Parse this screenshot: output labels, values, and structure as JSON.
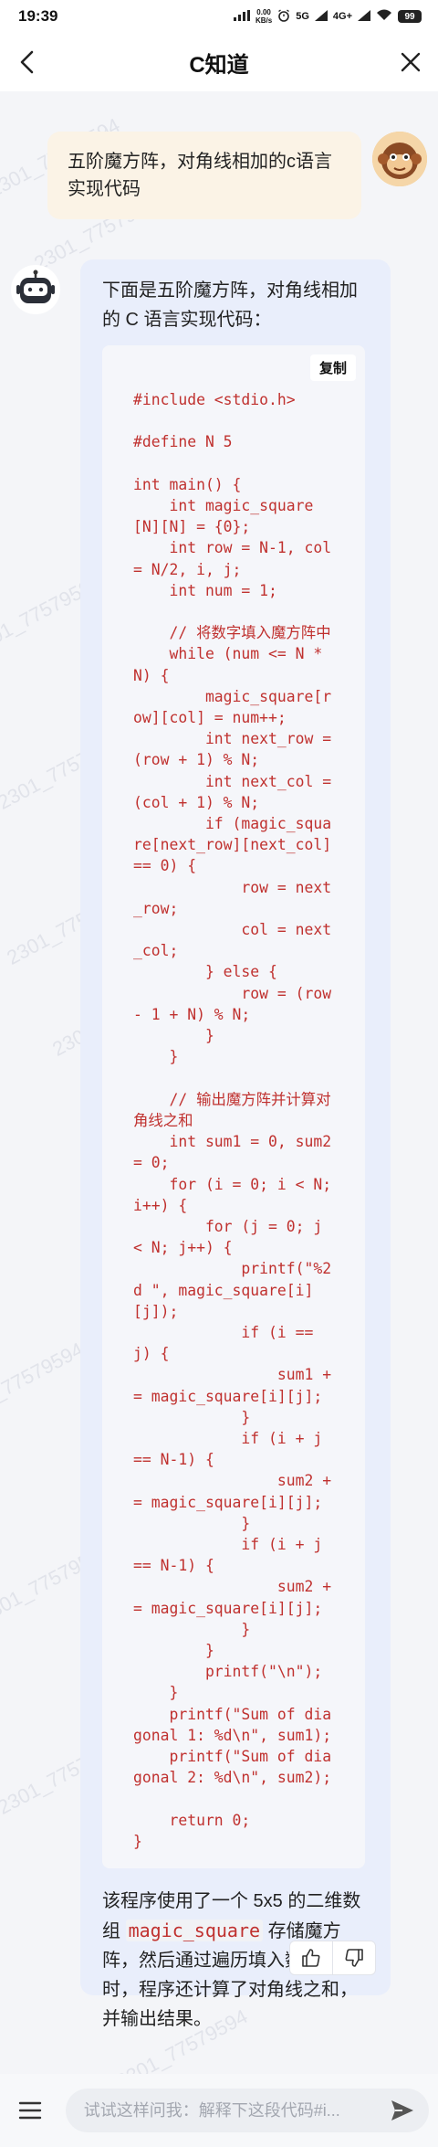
{
  "status": {
    "time": "19:39",
    "net_speed": "0.00\nKB/s",
    "network1": "5G",
    "network2": "4G+",
    "battery": "99"
  },
  "nav": {
    "title": "C知道"
  },
  "user_message": "五阶魔方阵，对角线相加的c语言实现代码",
  "bot": {
    "intro": "下面是五阶魔方阵，对角线相加的 C 语言实现代码：",
    "copy_label": "复制",
    "code": "#include <stdio.h>\n\n#define N 5\n\nint main() {\n    int magic_square\n[N][N] = {0};\n    int row = N-1, col\n= N/2, i, j;\n    int num = 1;\n\n    // 将数字填入魔方阵中\n    while (num <= N *\nN) {\n        magic_square[r\now][col] = num++;\n        int next_row =\n(row + 1) % N;\n        int next_col =\n(col + 1) % N;\n        if (magic_squa\nre[next_row][next_col]\n== 0) {\n            row = next\n_row;\n            col = next\n_col;\n        } else {\n            row = (row\n- 1 + N) % N;\n        }\n    }\n\n    // 输出魔方阵并计算对\n角线之和\n    int sum1 = 0, sum2\n= 0;\n    for (i = 0; i < N;\ni++) {\n        for (j = 0; j\n< N; j++) {\n            printf(\"%2\nd \", magic_square[i]\n[j]);\n            if (i ==\nj) {\n                sum1 +\n= magic_square[i][j];\n            }\n            if (i + j\n== N-1) {\n                sum2 +\n= magic_square[i][j];\n            }\n            if (i + j\n== N-1) {\n                sum2 +\n= magic_square[i][j];\n            }\n        }\n        printf(\"\\n\");\n    }\n    printf(\"Sum of dia\ngonal 1: %d\\n\", sum1);\n    printf(\"Sum of dia\ngonal 2: %d\\n\", sum2);\n\n    return 0;\n}",
    "outro_pre": "该程序使用了一个 5x5 的二维数组 ",
    "outro_code": "magic_square",
    "outro_post": " 存储魔方阵，然后通过遍历填入数字。同时，程序还计算了对角线之和，并输出结果。"
  },
  "input": {
    "placeholder": "试试这样问我：解释下这段代码#i..."
  },
  "watermark_text": "2301_77579594"
}
